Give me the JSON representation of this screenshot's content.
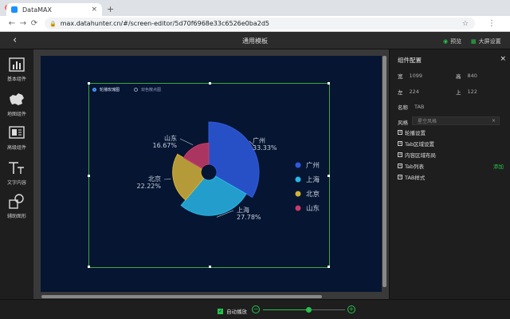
{
  "browser": {
    "tab_title": "DataMAX",
    "url": "max.datahunter.cn/#/screen-editor/5d70f6968e33c6526e0ba2d5"
  },
  "header": {
    "title": "通用模板",
    "preview_label": "预览",
    "bigscreen_label": "大屏设置"
  },
  "toolbar": {
    "items": [
      {
        "label": "基本组件",
        "icon": "bar-chart-icon"
      },
      {
        "label": "地图组件",
        "icon": "map-icon"
      },
      {
        "label": "高级组件",
        "icon": "advanced-components-icon"
      },
      {
        "label": "文字内容",
        "icon": "text-icon"
      },
      {
        "label": "辅助图形",
        "icon": "shapes-icon"
      }
    ]
  },
  "canvas": {
    "tabs": [
      {
        "label": "轮播玫瑰图",
        "active": true
      },
      {
        "label": "双色散点图",
        "active": false
      }
    ]
  },
  "chart_data": {
    "type": "pie",
    "subtype": "rose",
    "categories": [
      "广州",
      "上海",
      "北京",
      "山东"
    ],
    "values": [
      33.33,
      27.78,
      22.22,
      16.67
    ],
    "labels": [
      "33.33%",
      "27.78%",
      "22.22%",
      "16.67%"
    ],
    "colors": [
      "#2f5ae0",
      "#29b6e8",
      "#d4b23a",
      "#c93b6a"
    ],
    "legend_position": "right",
    "title": ""
  },
  "panel": {
    "title": "组件配置",
    "width_label": "宽",
    "width_value": "1099",
    "height_label": "高",
    "height_value": "840",
    "left_label": "左",
    "left_value": "224",
    "top_label": "上",
    "top_value": "122",
    "name_label": "名称",
    "name_value": "TAB",
    "style_label": "风格",
    "style_value": "星空风格",
    "sections": [
      "轮播设置",
      "Tab区域设置",
      "内容区域布局",
      "Tab列表",
      "TAB样式"
    ],
    "add_label": "添加"
  },
  "bottom": {
    "autoplay_label": "自动播放",
    "zoom_level": 0.55
  }
}
